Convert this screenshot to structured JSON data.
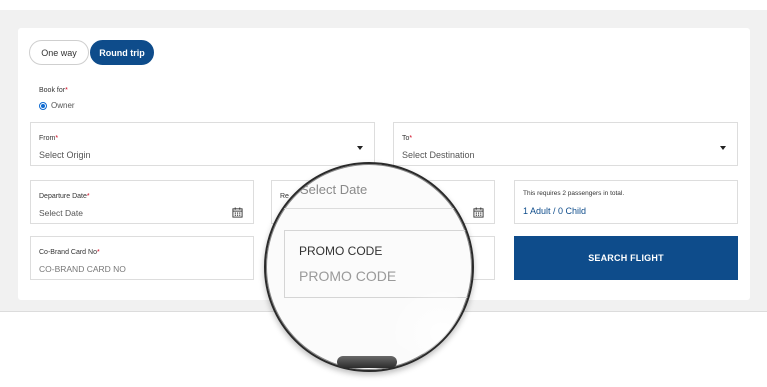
{
  "trip_type": {
    "one_way": "One way",
    "round_trip": "Round trip",
    "selected": "Round trip"
  },
  "book_for": {
    "label": "Book for",
    "required_mark": "*",
    "option": "Owner"
  },
  "from": {
    "label": "From",
    "required_mark": "*",
    "placeholder": "Select Origin"
  },
  "to": {
    "label": "To",
    "required_mark": "*",
    "placeholder": "Select Destination"
  },
  "departure": {
    "label": "Departure Date",
    "required_mark": "*",
    "placeholder": "Select Date"
  },
  "return": {
    "label_partial": "Re",
    "placeholder": "Select Date"
  },
  "passengers": {
    "note": "This requires 2 passengers in total.",
    "value": "1 Adult / 0 Child"
  },
  "cobrand": {
    "label": "Co-Brand Card No",
    "required_mark": "*",
    "placeholder": "CO-BRAND CARD NO"
  },
  "promo": {
    "label": "PROMO CODE",
    "placeholder": "PROMO CODE"
  },
  "magnifier": {
    "top_text_fragment": "ate",
    "select_date": "Select Date"
  },
  "search_button": "SEARCH FLIGHT",
  "colors": {
    "primary": "#0e4c8b",
    "required": "#d0021b",
    "radio": "#0e6ad1"
  }
}
